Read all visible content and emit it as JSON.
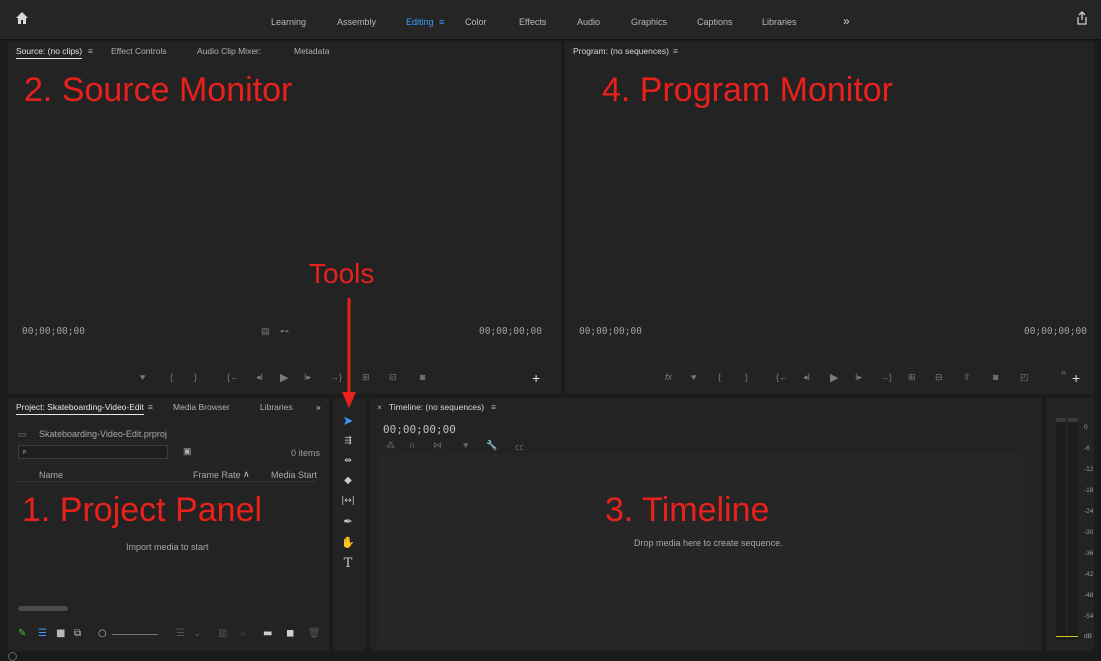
{
  "workspaces": {
    "items": [
      "Learning",
      "Assembly",
      "Editing",
      "Color",
      "Effects",
      "Audio",
      "Graphics",
      "Captions",
      "Libraries"
    ],
    "active": "Editing",
    "overflow": "»"
  },
  "source_panel": {
    "tabs": [
      "Source: (no clips)",
      "Effect Controls",
      "Audio Clip Mixer:",
      "Metadata"
    ],
    "timecode_in": "00;00;00;00",
    "timecode_out": "00;00;00;00"
  },
  "program_panel": {
    "tab": "Program: (no sequences)",
    "timecode_in": "00;00;00;00",
    "timecode_out": "00;00;00;00"
  },
  "project_panel": {
    "tabs": [
      "Project: Skateboarding-Video-Edit",
      "Media Browser",
      "Libraries"
    ],
    "overflow": "»",
    "file_name": "Skateboarding-Video-Edit.prproj",
    "items_count": "0 items",
    "columns": [
      "Name",
      "Frame Rate",
      "Media Start"
    ],
    "empty_message": "Import media to start"
  },
  "timeline_panel": {
    "tab": "Timeline: (no sequences)",
    "timecode": "00;00;00;00",
    "empty_message": "Drop media here to create sequence."
  },
  "audio_meter": {
    "labels": [
      "0",
      "-6",
      "-12",
      "-18",
      "-24",
      "-30",
      "-36",
      "-42",
      "-48",
      "-54",
      "dB"
    ]
  },
  "annotations": {
    "source": "2. Source Monitor",
    "program": "4. Program Monitor",
    "tools": "Tools",
    "project": "1. Project Panel",
    "timeline": "3. Timeline"
  },
  "colors": {
    "accent": "#3a9bff",
    "annotation": "#e8211c",
    "panel_bg": "#232323",
    "app_bg": "#1b1b1b"
  }
}
